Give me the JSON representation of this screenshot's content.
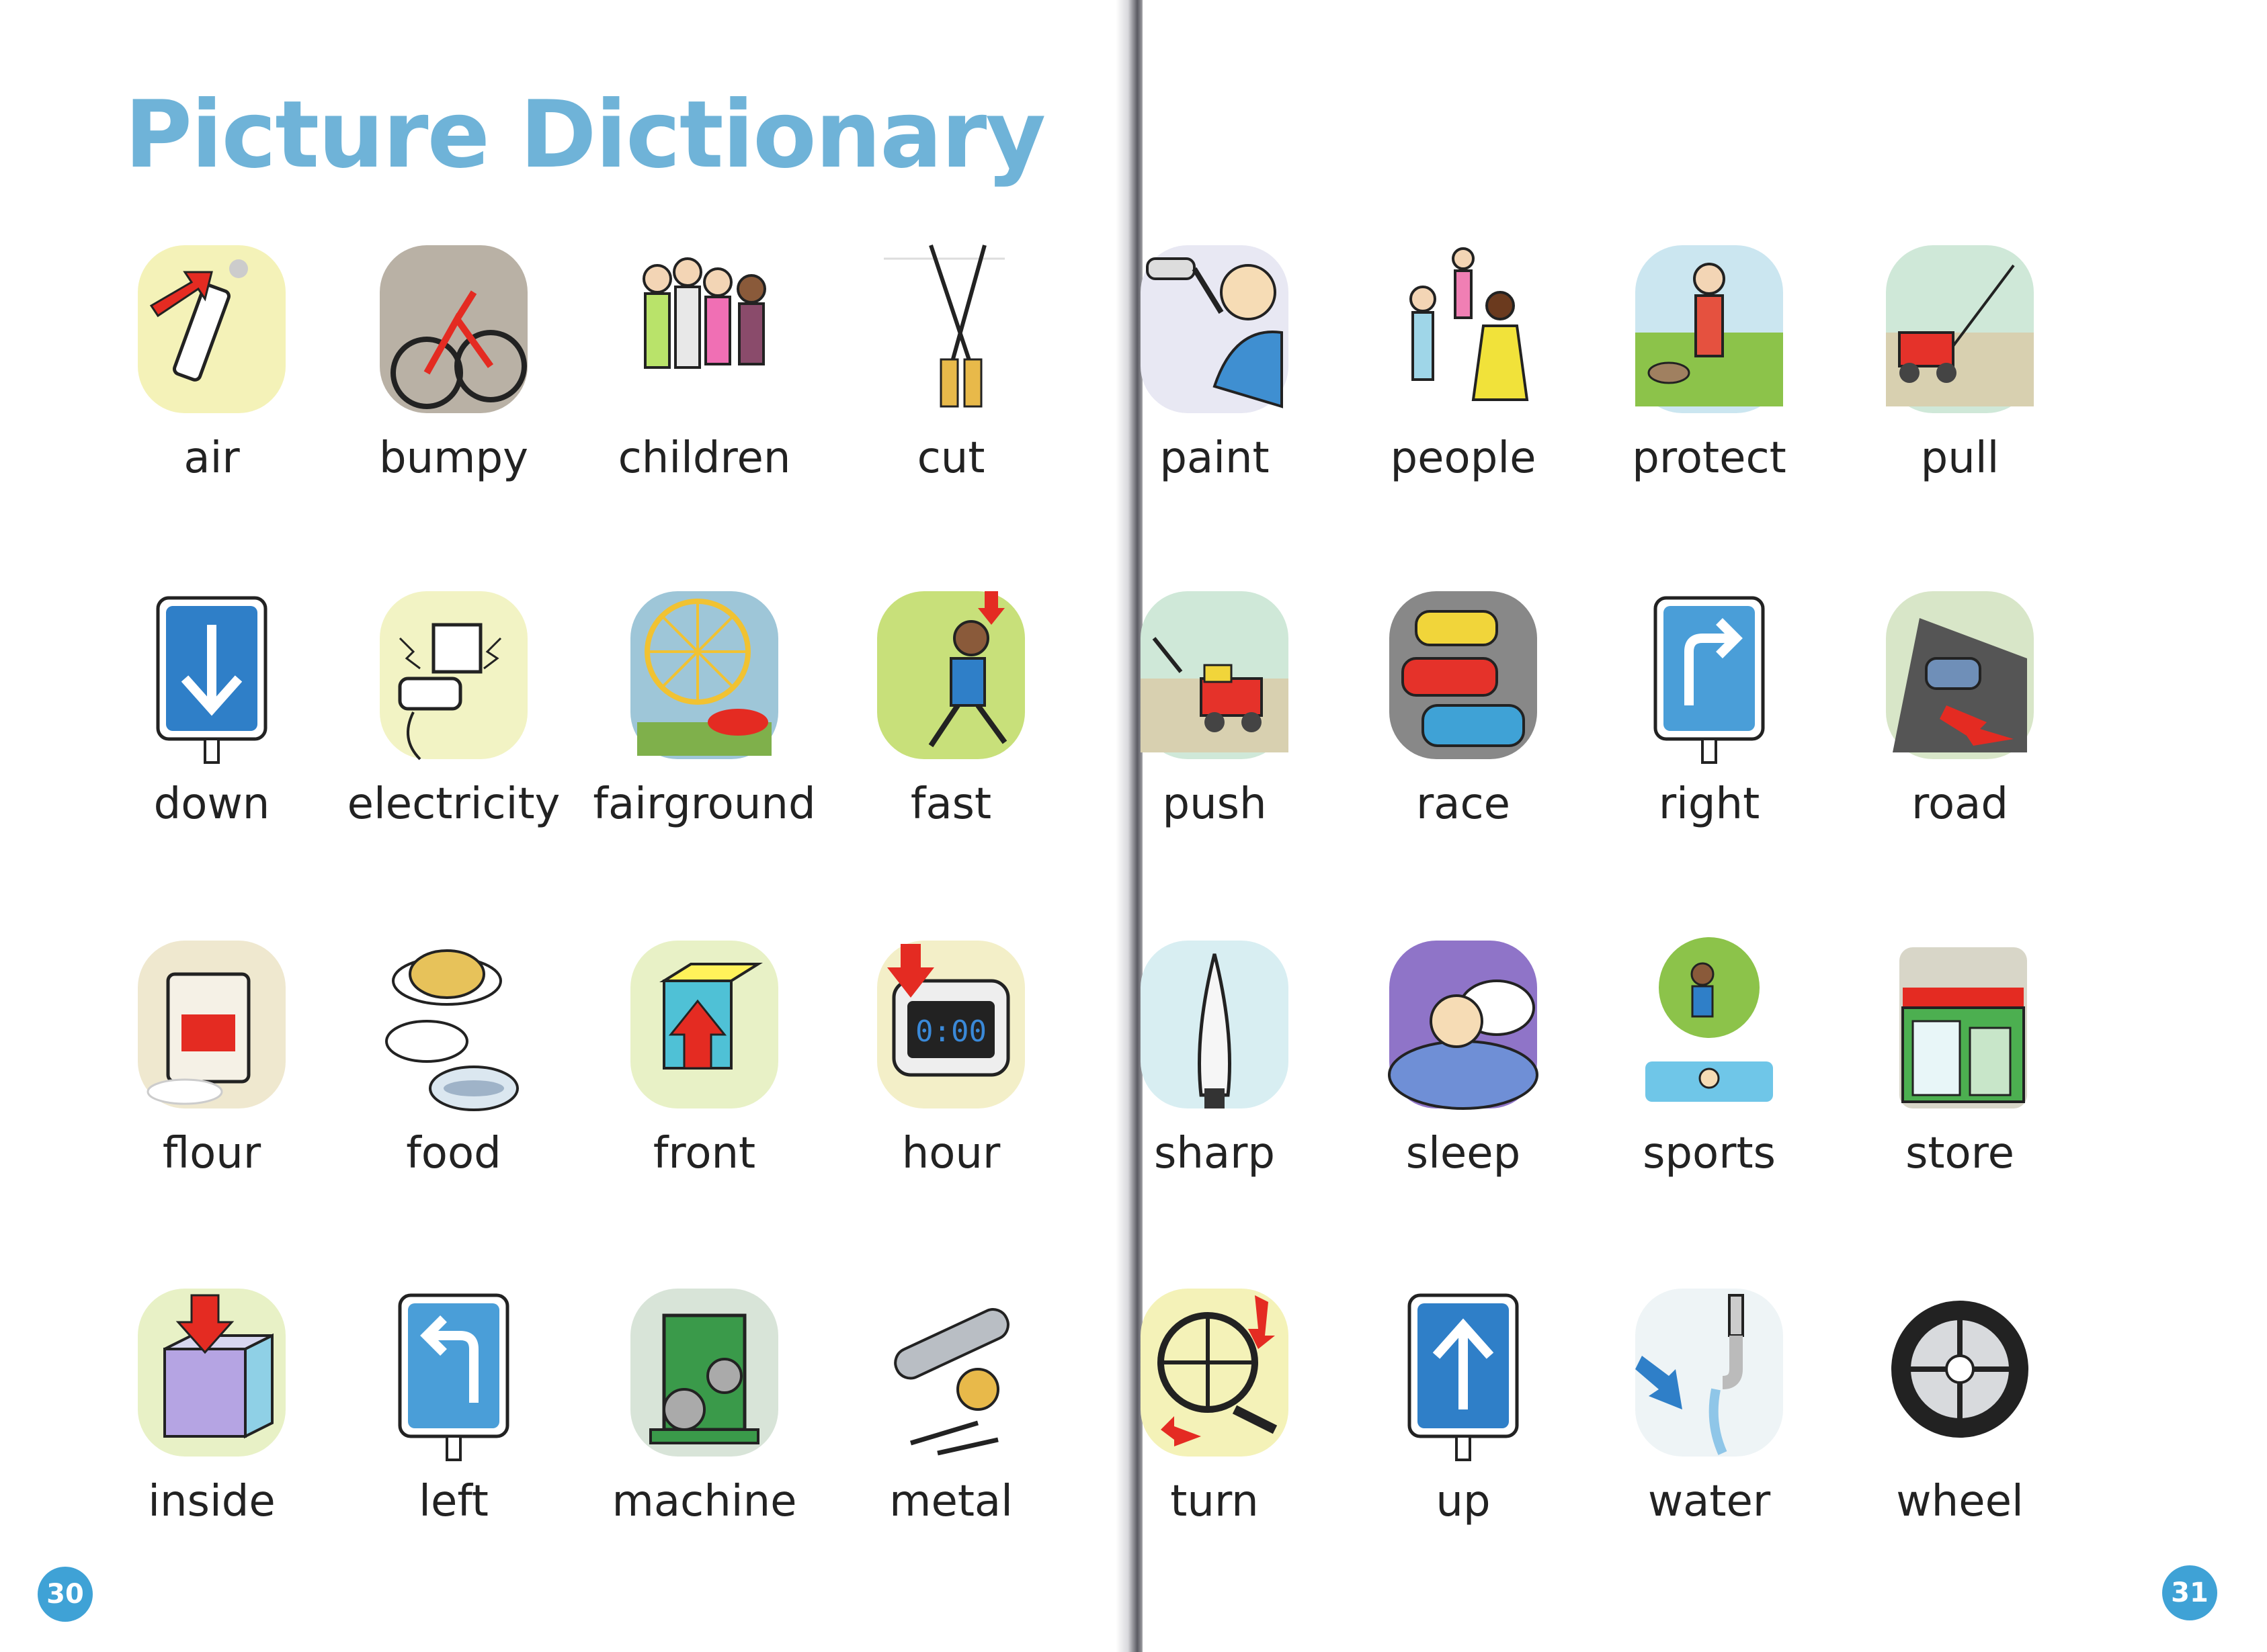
{
  "title": "Picture Dictionary",
  "left_page": {
    "number": "30",
    "entries": [
      {
        "word": "air",
        "icon": "air-pump-icon"
      },
      {
        "word": "bumpy",
        "icon": "bumpy-bike-icon"
      },
      {
        "word": "children",
        "icon": "children-icon"
      },
      {
        "word": "cut",
        "icon": "scissors-icon"
      },
      {
        "word": "down",
        "icon": "down-arrow-sign-icon"
      },
      {
        "word": "electricity",
        "icon": "electricity-icon"
      },
      {
        "word": "fairground",
        "icon": "fairground-icon"
      },
      {
        "word": "fast",
        "icon": "running-icon"
      },
      {
        "word": "flour",
        "icon": "flour-bag-icon"
      },
      {
        "word": "food",
        "icon": "food-plates-icon"
      },
      {
        "word": "front",
        "icon": "front-box-icon"
      },
      {
        "word": "hour",
        "icon": "alarm-clock-icon"
      },
      {
        "word": "inside",
        "icon": "inside-box-icon"
      },
      {
        "word": "left",
        "icon": "left-turn-sign-icon"
      },
      {
        "word": "machine",
        "icon": "machine-icon"
      },
      {
        "word": "metal",
        "icon": "metal-objects-icon"
      }
    ]
  },
  "right_page": {
    "number": "31",
    "entries": [
      {
        "word": "paint",
        "icon": "paint-roller-icon"
      },
      {
        "word": "people",
        "icon": "people-icon"
      },
      {
        "word": "protect",
        "icon": "protect-icon"
      },
      {
        "word": "pull",
        "icon": "pull-toy-icon"
      },
      {
        "word": "push",
        "icon": "push-toy-icon"
      },
      {
        "word": "race",
        "icon": "race-cars-icon"
      },
      {
        "word": "right",
        "icon": "right-turn-sign-icon"
      },
      {
        "word": "road",
        "icon": "road-icon"
      },
      {
        "word": "sharp",
        "icon": "knife-icon"
      },
      {
        "word": "sleep",
        "icon": "sleep-icon"
      },
      {
        "word": "sports",
        "icon": "sports-icon"
      },
      {
        "word": "store",
        "icon": "store-icon"
      },
      {
        "word": "turn",
        "icon": "valve-wheel-icon"
      },
      {
        "word": "up",
        "icon": "up-arrow-sign-icon"
      },
      {
        "word": "water",
        "icon": "water-tap-icon"
      },
      {
        "word": "wheel",
        "icon": "wheel-icon"
      }
    ]
  },
  "colors": {
    "title": "#6fb3d8",
    "page_number_badge": "#3fa2d6",
    "sign_blue": "#2f7fc8",
    "arrow_red": "#e42b22"
  }
}
